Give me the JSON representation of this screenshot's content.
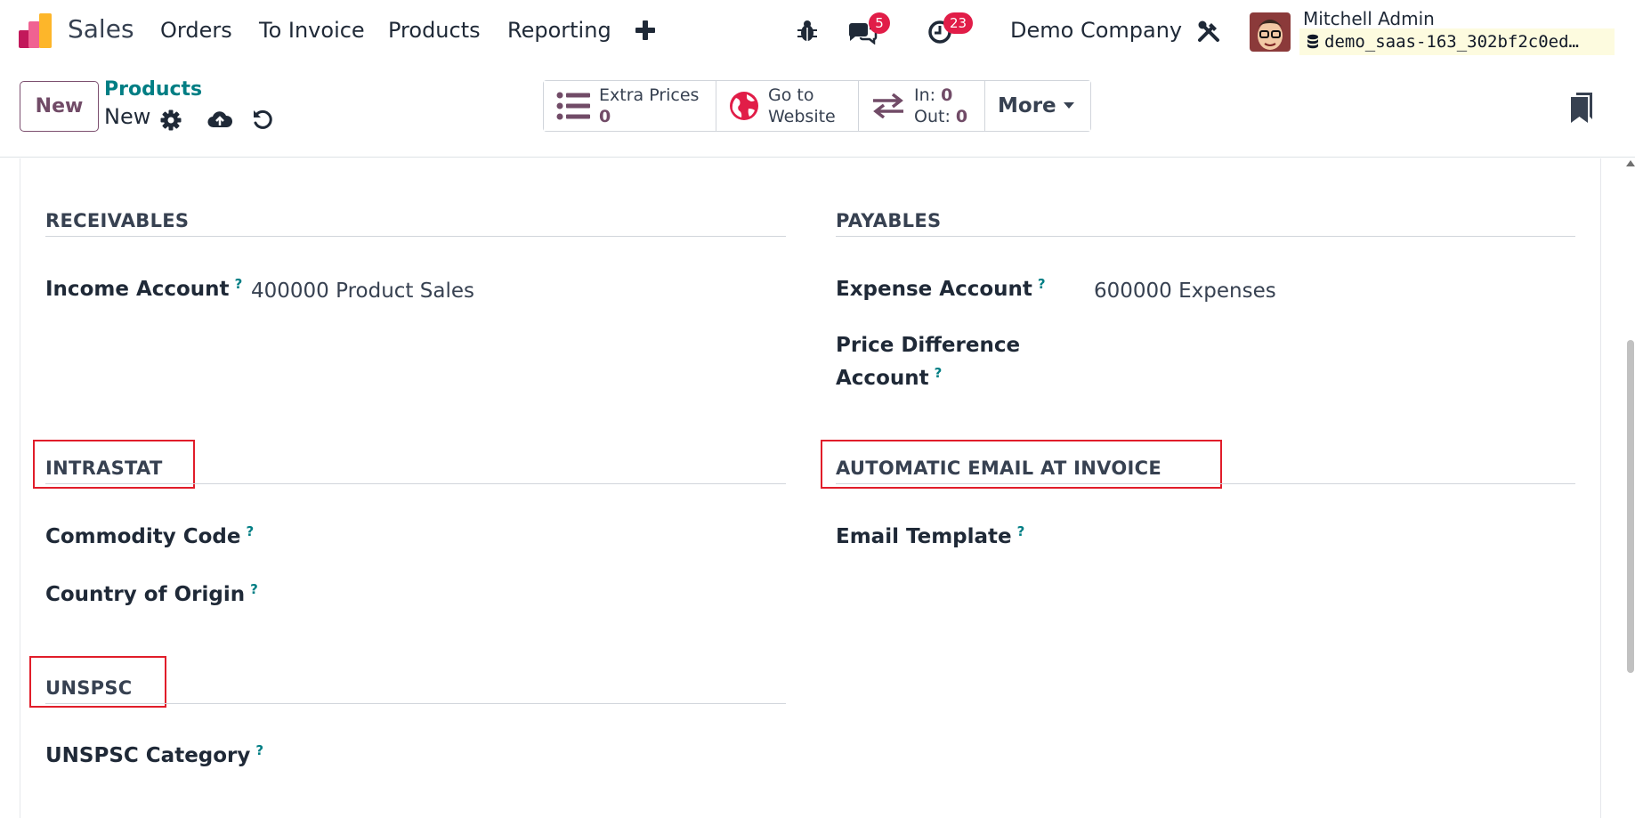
{
  "navbar": {
    "app_name": "Sales",
    "menu": [
      "Orders",
      "To Invoice",
      "Products",
      "Reporting"
    ],
    "messages_count": "5",
    "activities_count": "23",
    "company": "Demo Company",
    "user_name": "Mitchell Admin",
    "database": "demo_saas-163_302bf2c0ed…"
  },
  "control_panel": {
    "new_label": "New",
    "breadcrumb": "Products",
    "record_name": "New",
    "stats": {
      "extra_prices_label": "Extra Prices",
      "extra_prices_value": "0",
      "website_line1": "Go to",
      "website_line2": "Website",
      "in_label": "In:",
      "in_value": "0",
      "out_label": "Out:",
      "out_value": "0",
      "more_label": "More"
    }
  },
  "form": {
    "receivables": {
      "title": "RECEIVABLES",
      "income_account_label": "Income Account",
      "income_account_value": "400000 Product Sales"
    },
    "payables": {
      "title": "PAYABLES",
      "expense_account_label": "Expense Account",
      "expense_account_value": "600000 Expenses",
      "price_diff_label": "Price Difference Account"
    },
    "intrastat": {
      "title": "INTRASTAT",
      "commodity_label": "Commodity Code",
      "country_label": "Country of Origin"
    },
    "email": {
      "title": "AUTOMATIC EMAIL AT INVOICE",
      "template_label": "Email Template"
    },
    "unspsc": {
      "title": "UNSPSC",
      "category_label": "UNSPSC Category"
    },
    "help_mark": "?"
  },
  "colors": {
    "brand": "#714b67",
    "link": "#017e84",
    "badge": "#e11d48",
    "highlight": "#e11d2a"
  },
  "icons": [
    "sales-logo-icon",
    "plus-icon",
    "bug-icon",
    "chat-icon",
    "clock-icon",
    "tools-icon",
    "database-icon",
    "gear-icon",
    "cloud-upload-icon",
    "undo-icon",
    "list-icon",
    "globe-icon",
    "transfer-arrows-icon",
    "caret-down-icon",
    "bookmark-icon"
  ]
}
